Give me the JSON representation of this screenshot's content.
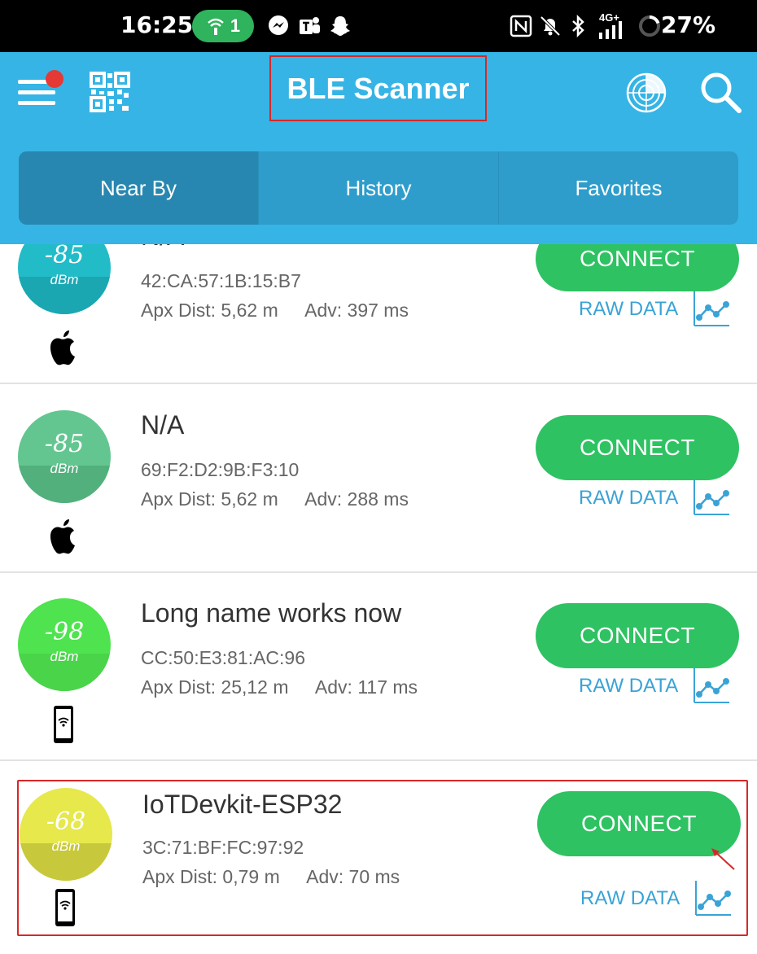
{
  "status_bar": {
    "time": "16:25",
    "hotspot_count": "1",
    "network": "4G+",
    "battery": "27%"
  },
  "header": {
    "title": "BLE Scanner",
    "icons": [
      "menu-icon",
      "qr-code-icon",
      "radar-icon",
      "search-icon"
    ],
    "accent_color": "#36b4e5"
  },
  "tabs": [
    {
      "label": "Near By",
      "selected": true
    },
    {
      "label": "History",
      "selected": false
    },
    {
      "label": "Favorites",
      "selected": false
    }
  ],
  "devices": [
    {
      "rssi": "-85",
      "unit": "dBm",
      "color": "#22bcc8",
      "color_dark": "#1aa7b2",
      "name": "N/A",
      "mac": "42:CA:57:1B:15:B7",
      "dist": "Apx Dist: 5,62 m",
      "adv": "Adv: 397 ms",
      "type_icon": "apple-icon",
      "connect_label": "CONNECT",
      "raw_label": "RAW DATA"
    },
    {
      "rssi": "-85",
      "unit": "dBm",
      "color": "#63c690",
      "color_dark": "#52b07d",
      "name": "N/A",
      "mac": "69:F2:D2:9B:F3:10",
      "dist": "Apx Dist: 5,62 m",
      "adv": "Adv: 288 ms",
      "type_icon": "apple-icon",
      "connect_label": "CONNECT",
      "raw_label": "RAW DATA"
    },
    {
      "rssi": "-98",
      "unit": "dBm",
      "color": "#4fe34f",
      "color_dark": "#49d449",
      "name": "Long name works now",
      "mac": "CC:50:E3:81:AC:96",
      "dist": "Apx Dist: 25,12 m",
      "adv": "Adv: 117 ms",
      "type_icon": "phone-icon",
      "connect_label": "CONNECT",
      "raw_label": "RAW DATA"
    },
    {
      "rssi": "-68",
      "unit": "dBm",
      "color": "#e6e84c",
      "color_dark": "#c8c83c",
      "name": "IoTDevkit-ESP32",
      "mac": "3C:71:BF:FC:97:92",
      "dist": "Apx Dist: 0,79 m",
      "adv": "Adv: 70 ms",
      "type_icon": "phone-icon",
      "connect_label": "CONNECT",
      "raw_label": "RAW DATA"
    }
  ],
  "colors": {
    "connect_green": "#2ec262",
    "raw_data_blue": "#3aa3d6",
    "highlight_red": "#d62828"
  }
}
